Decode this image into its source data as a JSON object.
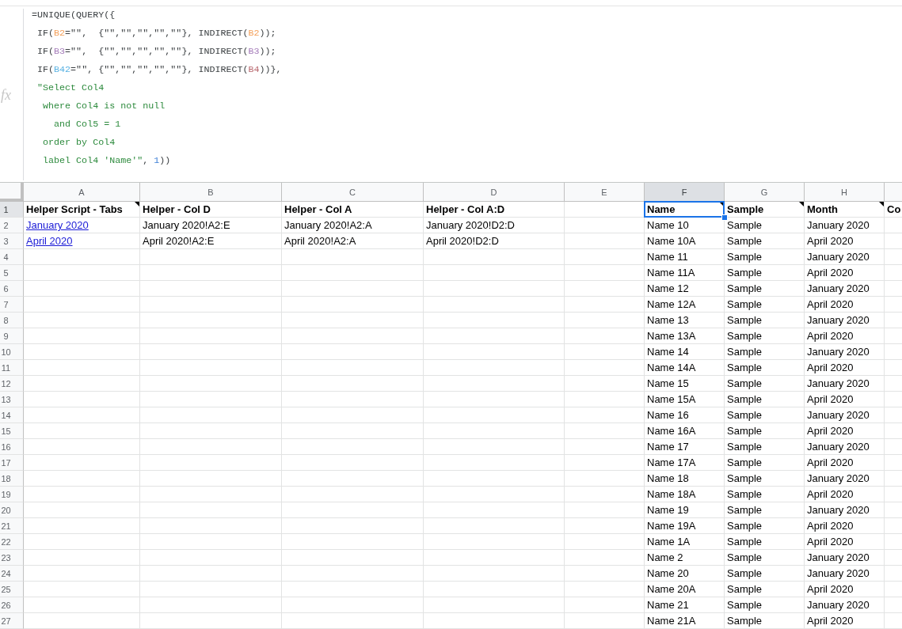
{
  "formula_bar": {
    "label": "fx",
    "lines": [
      {
        "tokens": [
          {
            "text": "=UNIQUE(QUERY({",
            "kind": "plain"
          }
        ]
      },
      {
        "tokens": [
          {
            "text": " IF(",
            "kind": "plain"
          },
          {
            "text": "B2",
            "kind": "ref",
            "color": "#f4a05a"
          },
          {
            "text": "=\"\",  {\"\",\"\",\"\",\"\",\"\"}, INDIRECT(",
            "kind": "plain"
          },
          {
            "text": "B2",
            "kind": "ref",
            "color": "#f4a05a"
          },
          {
            "text": "));",
            "kind": "plain"
          }
        ]
      },
      {
        "tokens": [
          {
            "text": " IF(",
            "kind": "plain"
          },
          {
            "text": "B3",
            "kind": "ref",
            "color": "#a47bb9"
          },
          {
            "text": "=\"\",  {\"\",\"\",\"\",\"\",\"\"}, INDIRECT(",
            "kind": "plain"
          },
          {
            "text": "B3",
            "kind": "ref",
            "color": "#a47bb9"
          },
          {
            "text": "));",
            "kind": "plain"
          }
        ]
      },
      {
        "tokens": [
          {
            "text": " IF(",
            "kind": "plain"
          },
          {
            "text": "B42",
            "kind": "ref",
            "color": "#5bb3e3"
          },
          {
            "text": "=\"\", {\"\",\"\",\"\",\"\",\"\"}, INDIRECT(",
            "kind": "plain"
          },
          {
            "text": "B4",
            "kind": "ref",
            "color": "#b9686f"
          },
          {
            "text": "))},",
            "kind": "plain"
          }
        ]
      },
      {
        "tokens": [
          {
            "text": " \"Select Col4",
            "kind": "string"
          }
        ]
      },
      {
        "tokens": [
          {
            "text": "  where Col4 is not null",
            "kind": "string"
          }
        ]
      },
      {
        "tokens": [
          {
            "text": "    and Col5 = 1",
            "kind": "string"
          }
        ]
      },
      {
        "tokens": [
          {
            "text": "  order by Col4",
            "kind": "string"
          }
        ]
      },
      {
        "tokens": [
          {
            "text": "  label Col4 'Name'\"",
            "kind": "string"
          },
          {
            "text": ", ",
            "kind": "plain"
          },
          {
            "text": "1",
            "kind": "number"
          },
          {
            "text": "))",
            "kind": "plain"
          }
        ]
      }
    ]
  },
  "sheet": {
    "columns": [
      {
        "label": "A",
        "selected": false
      },
      {
        "label": "B",
        "selected": false
      },
      {
        "label": "C",
        "selected": false
      },
      {
        "label": "D",
        "selected": false
      },
      {
        "label": "E",
        "selected": false
      },
      {
        "label": "F",
        "selected": true
      },
      {
        "label": "G",
        "selected": false
      },
      {
        "label": "H",
        "selected": false
      }
    ],
    "row_headers": [
      {
        "label": "1",
        "selected": true
      },
      {
        "label": "2",
        "selected": false
      },
      {
        "label": "3",
        "selected": false
      },
      {
        "label": "4",
        "selected": false
      },
      {
        "label": "5",
        "selected": false
      },
      {
        "label": "6",
        "selected": false
      },
      {
        "label": "7",
        "selected": false
      },
      {
        "label": "8",
        "selected": false
      },
      {
        "label": "9",
        "selected": false
      },
      {
        "label": "10",
        "selected": false
      },
      {
        "label": "11",
        "selected": false
      },
      {
        "label": "12",
        "selected": false
      },
      {
        "label": "13",
        "selected": false
      },
      {
        "label": "14",
        "selected": false
      },
      {
        "label": "15",
        "selected": false
      },
      {
        "label": "16",
        "selected": false
      },
      {
        "label": "17",
        "selected": false
      },
      {
        "label": "18",
        "selected": false
      },
      {
        "label": "19",
        "selected": false
      },
      {
        "label": "20",
        "selected": false
      },
      {
        "label": "21",
        "selected": false
      },
      {
        "label": "22",
        "selected": false
      },
      {
        "label": "23",
        "selected": false
      },
      {
        "label": "24",
        "selected": false
      },
      {
        "label": "25",
        "selected": false
      },
      {
        "label": "26",
        "selected": false
      },
      {
        "label": "27",
        "selected": false
      }
    ],
    "helper_table": {
      "header": [
        {
          "text": "Helper Script - Tabs",
          "has_note": true,
          "selected": false
        },
        {
          "text": "Helper - Col D",
          "has_note": false,
          "selected": false
        },
        {
          "text": "Helper - Col A",
          "has_note": false,
          "selected": false
        },
        {
          "text": "Helper - Col A:D",
          "has_note": false,
          "selected": false
        }
      ],
      "rows": [
        [
          {
            "text": "January 2020",
            "kind": "link"
          },
          {
            "text": "January 2020!A2:E",
            "kind": "text"
          },
          {
            "text": "January 2020!A2:A",
            "kind": "text"
          },
          {
            "text": "January 2020!D2:D",
            "kind": "text"
          }
        ],
        [
          {
            "text": "April 2020",
            "kind": "link"
          },
          {
            "text": "April 2020!A2:E",
            "kind": "text"
          },
          {
            "text": "April 2020!A2:A",
            "kind": "text"
          },
          {
            "text": "April 2020!D2:D",
            "kind": "text"
          }
        ]
      ]
    },
    "results": {
      "header": [
        {
          "text": "Name",
          "has_note": true,
          "selected": true
        },
        {
          "text": "Sample",
          "has_note": true,
          "selected": false
        },
        {
          "text": "Month",
          "has_note": true,
          "selected": false
        },
        {
          "text": "Co",
          "has_note": false,
          "selected": false
        }
      ],
      "rows": [
        [
          "Name 10",
          "Sample",
          "January 2020"
        ],
        [
          "Name 10A",
          "Sample",
          "April 2020"
        ],
        [
          "Name 11",
          "Sample",
          "January 2020"
        ],
        [
          "Name 11A",
          "Sample",
          "April 2020"
        ],
        [
          "Name 12",
          "Sample",
          "January 2020"
        ],
        [
          "Name 12A",
          "Sample",
          "April 2020"
        ],
        [
          "Name 13",
          "Sample",
          "January 2020"
        ],
        [
          "Name 13A",
          "Sample",
          "April 2020"
        ],
        [
          "Name 14",
          "Sample",
          "January 2020"
        ],
        [
          "Name 14A",
          "Sample",
          "April 2020"
        ],
        [
          "Name 15",
          "Sample",
          "January 2020"
        ],
        [
          "Name 15A",
          "Sample",
          "April 2020"
        ],
        [
          "Name 16",
          "Sample",
          "January 2020"
        ],
        [
          "Name 16A",
          "Sample",
          "April 2020"
        ],
        [
          "Name 17",
          "Sample",
          "January 2020"
        ],
        [
          "Name 17A",
          "Sample",
          "April 2020"
        ],
        [
          "Name 18",
          "Sample",
          "January 2020"
        ],
        [
          "Name 18A",
          "Sample",
          "April 2020"
        ],
        [
          "Name 19",
          "Sample",
          "January 2020"
        ],
        [
          "Name 19A",
          "Sample",
          "April 2020"
        ],
        [
          "Name 1A",
          "Sample",
          "April 2020"
        ],
        [
          "Name 2",
          "Sample",
          "January 2020"
        ],
        [
          "Name 20",
          "Sample",
          "January 2020"
        ],
        [
          "Name 20A",
          "Sample",
          "April 2020"
        ],
        [
          "Name 21",
          "Sample",
          "January 2020"
        ],
        [
          "Name 21A",
          "Sample",
          "April 2020"
        ]
      ]
    }
  }
}
